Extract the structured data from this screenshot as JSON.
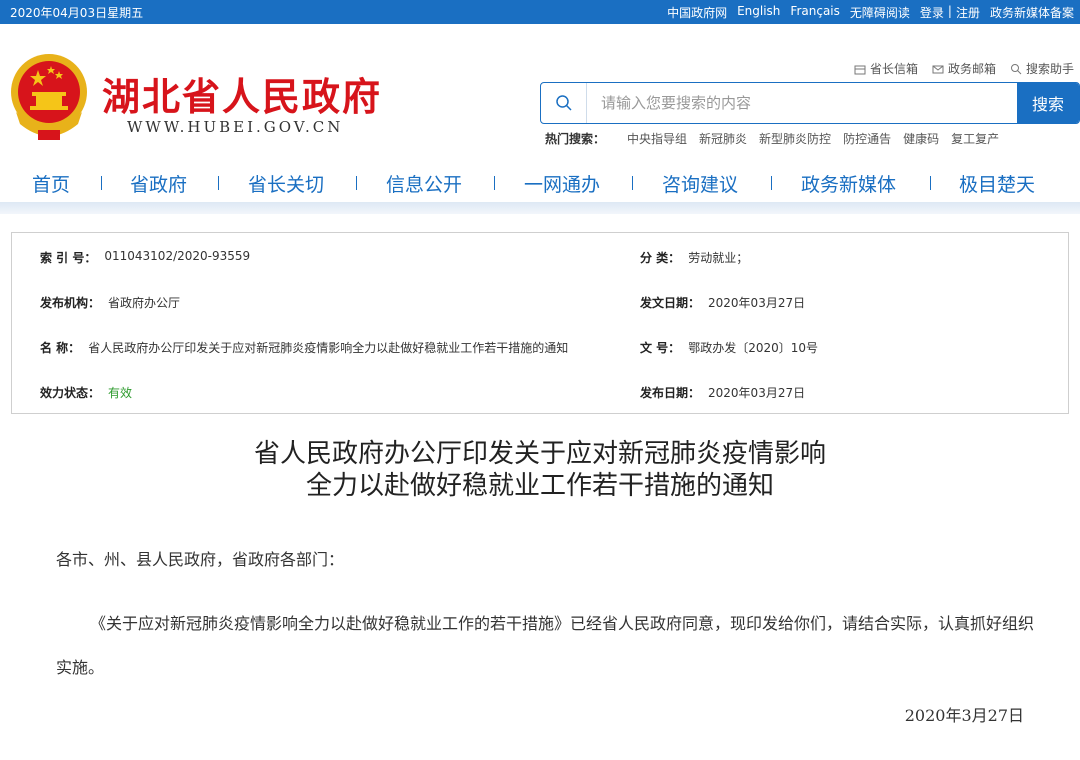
{
  "topbar": {
    "date": "2020年04月03日星期五",
    "links": [
      "中国政府网",
      "English",
      "Français",
      "无障碍阅读",
      "登录",
      "|",
      "注册",
      "政务新媒体备案"
    ]
  },
  "header": {
    "title": "湖北省人民政府",
    "url": "WWW.HUBEI.GOV.CN",
    "tools": [
      {
        "label": "省长信箱",
        "icon": "mailbox-icon"
      },
      {
        "label": "政务邮箱",
        "icon": "envelope-icon"
      },
      {
        "label": "搜索助手",
        "icon": "search-icon"
      }
    ]
  },
  "search": {
    "placeholder": "请输入您要搜索的内容",
    "button": "搜索"
  },
  "hot": {
    "label": "热门搜索：",
    "items": [
      "中央指导组",
      "新冠肺炎",
      "新型肺炎防控",
      "防控通告",
      "健康码",
      "复工复产"
    ]
  },
  "nav": [
    "首页",
    "省政府",
    "省长关切",
    "信息公开",
    "一网通办",
    "咨询建议",
    "政务新媒体",
    "极目楚天"
  ],
  "meta": {
    "index_k": "索 引 号：",
    "index_v": "011043102/2020-93559",
    "category_k": "分 类：",
    "category_v": "劳动就业；",
    "org_k": "发布机构：",
    "org_v": "省政府办公厅",
    "issue_date_k": "发文日期：",
    "issue_date_v": "2020年03月27日",
    "name_k": "名 称：",
    "name_v": "省人民政府办公厅印发关于应对新冠肺炎疫情影响全力以赴做好稳就业工作若干措施的通知",
    "doc_no_k": "文 号：",
    "doc_no_v": "鄂政办发〔2020〕10号",
    "status_k": "效力状态：",
    "status_v": "有效",
    "pub_date_k": "发布日期：",
    "pub_date_v": "2020年03月27日"
  },
  "article": {
    "title_line1": "省人民政府办公厅印发关于应对新冠肺炎疫情影响",
    "title_line2": "全力以赴做好稳就业工作若干措施的通知",
    "salutation": "各市、州、县人民政府，省政府各部门：",
    "body": "《关于应对新冠肺炎疫情影响全力以赴做好稳就业工作的若干措施》已经省人民政府同意，现印发给你们，请结合实际，认真抓好组织实施。",
    "date": "2020年3月27日"
  },
  "colors": {
    "brand_blue": "#1a6fc2",
    "title_red": "#d7141b",
    "status_green": "#2c9a2c"
  }
}
